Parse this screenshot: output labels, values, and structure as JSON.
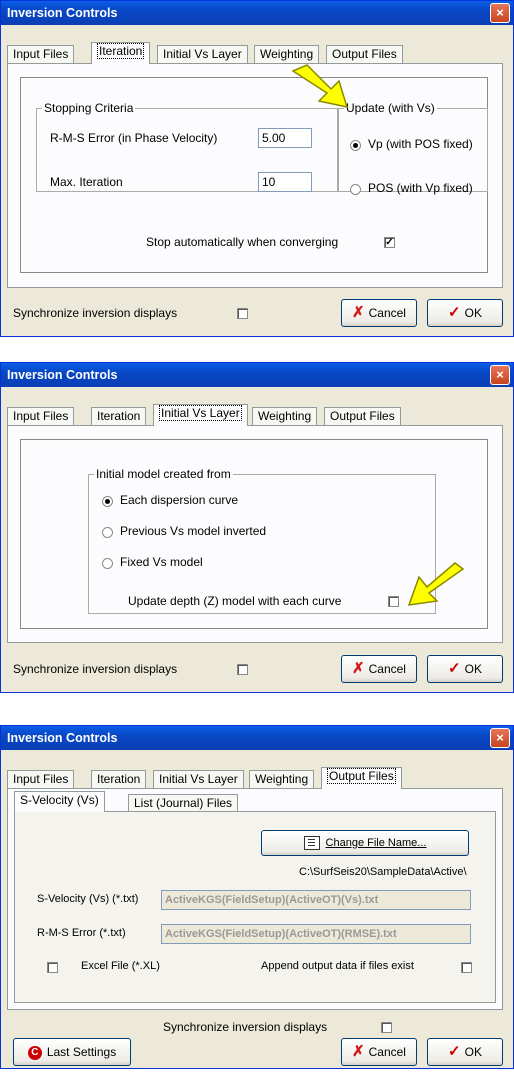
{
  "dialog1": {
    "title": "Inversion Controls",
    "close": "×",
    "tabs": [
      "Input Files",
      "Iteration",
      "Initial Vs Layer",
      "Weighting",
      "Output Files"
    ],
    "stopping": {
      "label": "Stopping Criteria",
      "rms_label": "R-M-S Error (in Phase Velocity)",
      "rms_value": "5.00",
      "maxit_label": "Max. Iteration",
      "maxit_value": "10"
    },
    "update": {
      "label": "Update (with Vs)",
      "opt1": "Vp (with POS fixed)",
      "opt2": "POS (with Vp fixed)"
    },
    "stop_auto": "Stop automatically when converging",
    "stop_auto_mark": "✓",
    "sync": "Synchronize inversion displays",
    "cancel": "Cancel",
    "ok": "OK",
    "cancel_icon": "✗",
    "ok_icon": "✓"
  },
  "dialog2": {
    "title": "Inversion Controls",
    "close": "×",
    "tabs": [
      "Input Files",
      "Iteration",
      "Initial Vs Layer",
      "Weighting",
      "Output Files"
    ],
    "group_label": "Initial model created from",
    "opt1": "Each dispersion curve",
    "opt2": "Previous Vs model inverted",
    "opt3": "Fixed Vs model",
    "update_depth": "Update depth (Z) model with each curve",
    "sync": "Synchronize inversion displays",
    "cancel": "Cancel",
    "ok": "OK",
    "cancel_icon": "✗",
    "ok_icon": "✓"
  },
  "dialog3": {
    "title": "Inversion Controls",
    "close": "×",
    "tabs": [
      "Input Files",
      "Iteration",
      "Initial Vs Layer",
      "Weighting",
      "Output Files"
    ],
    "subtabs": [
      "S-Velocity (Vs)",
      "List (Journal) Files"
    ],
    "change_file": "Change File Name...",
    "path": "C:\\SurfSeis20\\SampleData\\Active\\",
    "svel_label": "S-Velocity (Vs) (*.txt)",
    "svel_value": "ActiveKGS(FieldSetup)(ActiveOT)(Vs).txt",
    "rms_label": "R-M-S Error (*.txt)",
    "rms_value": "ActiveKGS(FieldSetup)(ActiveOT)(RMSE).txt",
    "excel": "Excel File (*.XL)",
    "append": "Append output data if files exist",
    "sync": "Synchronize inversion displays",
    "last": "Last Settings",
    "cancel": "Cancel",
    "ok": "OK",
    "cancel_icon": "✗",
    "ok_icon": "✓",
    "last_icon": "C"
  },
  "colors": {
    "arrow": "#ffff00",
    "title": "#0a5ee8",
    "face": "#ece9d8"
  }
}
